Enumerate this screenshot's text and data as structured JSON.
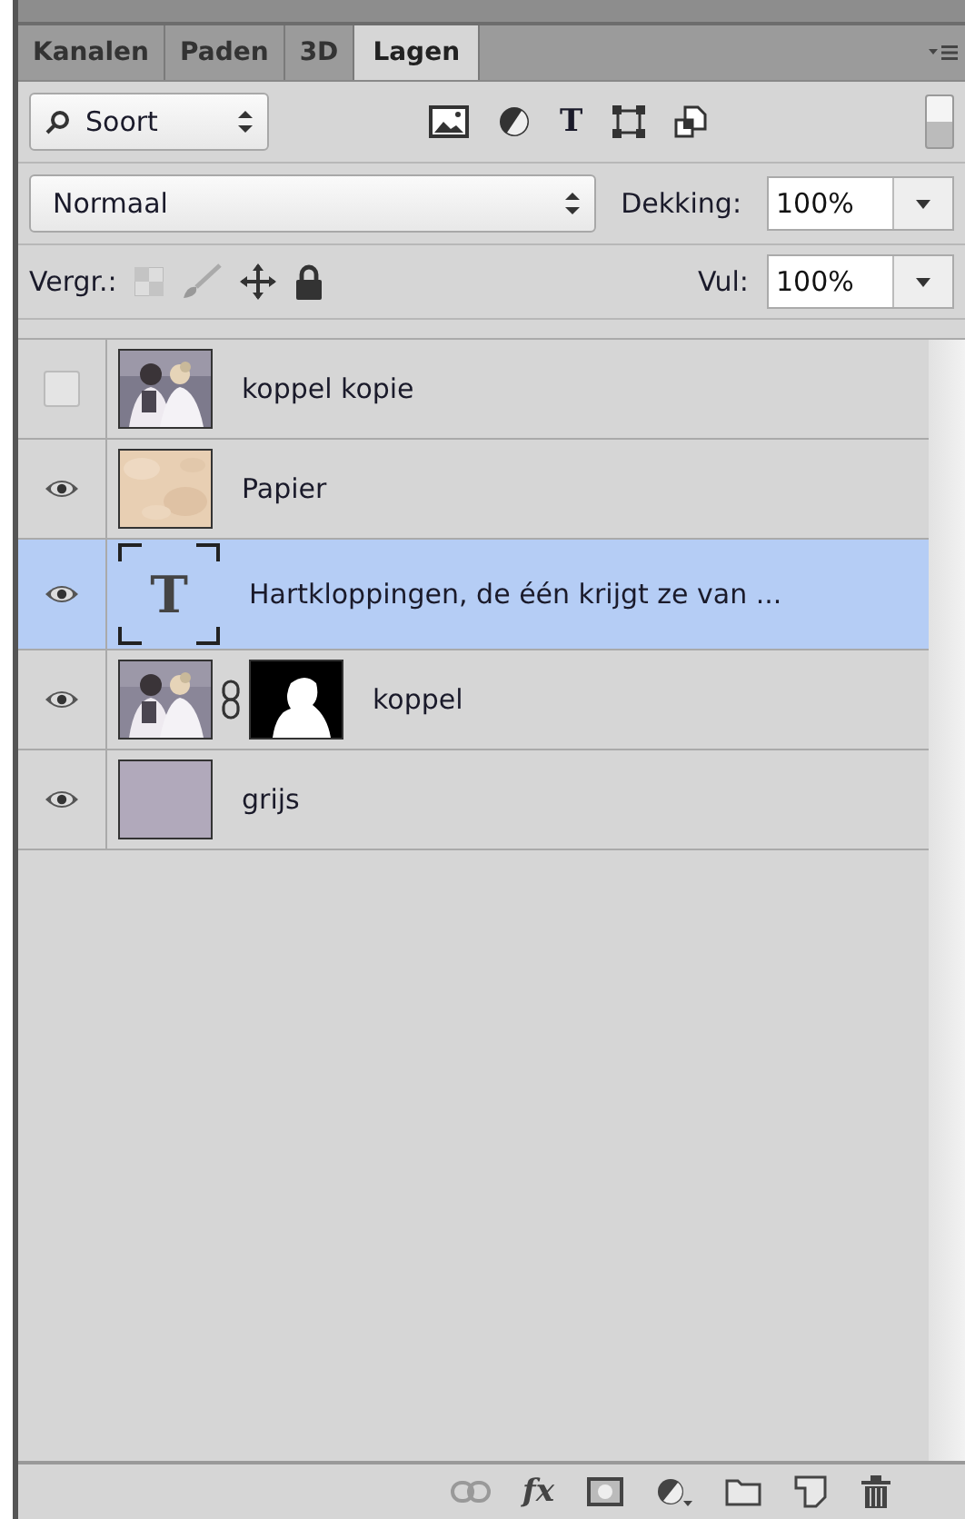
{
  "tabs": [
    {
      "label": "Kanalen",
      "selected": false
    },
    {
      "label": "Paden",
      "selected": false
    },
    {
      "label": "3D",
      "selected": false
    },
    {
      "label": "Lagen",
      "selected": true
    }
  ],
  "filter": {
    "value": "Soort",
    "type_glyph": "T"
  },
  "blend": {
    "value": "Normaal",
    "opacity_label": "Dekking:",
    "opacity": "100%"
  },
  "lock": {
    "label": "Vergr.:",
    "fill_label": "Vul:",
    "fill": "100%"
  },
  "layers": [
    {
      "name": "koppel kopie",
      "visible": false,
      "selected": false
    },
    {
      "name": "Papier",
      "kind": "paper",
      "visible": true,
      "selected": false
    },
    {
      "name": "Hartkloppingen, de één krijgt ze van ...",
      "kind": "text",
      "glyph": "T",
      "visible": true,
      "selected": true
    },
    {
      "name": "koppel",
      "kind": "masked",
      "visible": true,
      "selected": false
    },
    {
      "name": "grijs",
      "kind": "fill",
      "visible": true,
      "selected": false
    }
  ],
  "footer": {
    "fx": "fx"
  }
}
